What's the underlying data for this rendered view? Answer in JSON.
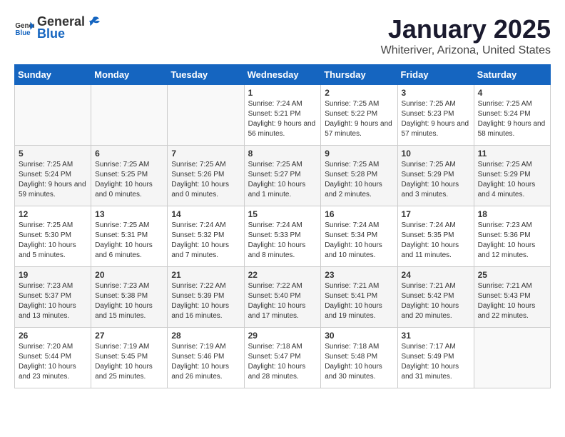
{
  "header": {
    "logo_general": "General",
    "logo_blue": "Blue",
    "title": "January 2025",
    "subtitle": "Whiteriver, Arizona, United States"
  },
  "days_of_week": [
    "Sunday",
    "Monday",
    "Tuesday",
    "Wednesday",
    "Thursday",
    "Friday",
    "Saturday"
  ],
  "weeks": [
    [
      {
        "day": "",
        "sunrise": "",
        "sunset": "",
        "daylight": ""
      },
      {
        "day": "",
        "sunrise": "",
        "sunset": "",
        "daylight": ""
      },
      {
        "day": "",
        "sunrise": "",
        "sunset": "",
        "daylight": ""
      },
      {
        "day": "1",
        "sunrise": "7:24 AM",
        "sunset": "5:21 PM",
        "daylight": "9 hours and 56 minutes."
      },
      {
        "day": "2",
        "sunrise": "7:25 AM",
        "sunset": "5:22 PM",
        "daylight": "9 hours and 57 minutes."
      },
      {
        "day": "3",
        "sunrise": "7:25 AM",
        "sunset": "5:23 PM",
        "daylight": "9 hours and 57 minutes."
      },
      {
        "day": "4",
        "sunrise": "7:25 AM",
        "sunset": "5:24 PM",
        "daylight": "9 hours and 58 minutes."
      }
    ],
    [
      {
        "day": "5",
        "sunrise": "7:25 AM",
        "sunset": "5:24 PM",
        "daylight": "9 hours and 59 minutes."
      },
      {
        "day": "6",
        "sunrise": "7:25 AM",
        "sunset": "5:25 PM",
        "daylight": "10 hours and 0 minutes."
      },
      {
        "day": "7",
        "sunrise": "7:25 AM",
        "sunset": "5:26 PM",
        "daylight": "10 hours and 0 minutes."
      },
      {
        "day": "8",
        "sunrise": "7:25 AM",
        "sunset": "5:27 PM",
        "daylight": "10 hours and 1 minute."
      },
      {
        "day": "9",
        "sunrise": "7:25 AM",
        "sunset": "5:28 PM",
        "daylight": "10 hours and 2 minutes."
      },
      {
        "day": "10",
        "sunrise": "7:25 AM",
        "sunset": "5:29 PM",
        "daylight": "10 hours and 3 minutes."
      },
      {
        "day": "11",
        "sunrise": "7:25 AM",
        "sunset": "5:29 PM",
        "daylight": "10 hours and 4 minutes."
      }
    ],
    [
      {
        "day": "12",
        "sunrise": "7:25 AM",
        "sunset": "5:30 PM",
        "daylight": "10 hours and 5 minutes."
      },
      {
        "day": "13",
        "sunrise": "7:25 AM",
        "sunset": "5:31 PM",
        "daylight": "10 hours and 6 minutes."
      },
      {
        "day": "14",
        "sunrise": "7:24 AM",
        "sunset": "5:32 PM",
        "daylight": "10 hours and 7 minutes."
      },
      {
        "day": "15",
        "sunrise": "7:24 AM",
        "sunset": "5:33 PM",
        "daylight": "10 hours and 8 minutes."
      },
      {
        "day": "16",
        "sunrise": "7:24 AM",
        "sunset": "5:34 PM",
        "daylight": "10 hours and 10 minutes."
      },
      {
        "day": "17",
        "sunrise": "7:24 AM",
        "sunset": "5:35 PM",
        "daylight": "10 hours and 11 minutes."
      },
      {
        "day": "18",
        "sunrise": "7:23 AM",
        "sunset": "5:36 PM",
        "daylight": "10 hours and 12 minutes."
      }
    ],
    [
      {
        "day": "19",
        "sunrise": "7:23 AM",
        "sunset": "5:37 PM",
        "daylight": "10 hours and 13 minutes."
      },
      {
        "day": "20",
        "sunrise": "7:23 AM",
        "sunset": "5:38 PM",
        "daylight": "10 hours and 15 minutes."
      },
      {
        "day": "21",
        "sunrise": "7:22 AM",
        "sunset": "5:39 PM",
        "daylight": "10 hours and 16 minutes."
      },
      {
        "day": "22",
        "sunrise": "7:22 AM",
        "sunset": "5:40 PM",
        "daylight": "10 hours and 17 minutes."
      },
      {
        "day": "23",
        "sunrise": "7:21 AM",
        "sunset": "5:41 PM",
        "daylight": "10 hours and 19 minutes."
      },
      {
        "day": "24",
        "sunrise": "7:21 AM",
        "sunset": "5:42 PM",
        "daylight": "10 hours and 20 minutes."
      },
      {
        "day": "25",
        "sunrise": "7:21 AM",
        "sunset": "5:43 PM",
        "daylight": "10 hours and 22 minutes."
      }
    ],
    [
      {
        "day": "26",
        "sunrise": "7:20 AM",
        "sunset": "5:44 PM",
        "daylight": "10 hours and 23 minutes."
      },
      {
        "day": "27",
        "sunrise": "7:19 AM",
        "sunset": "5:45 PM",
        "daylight": "10 hours and 25 minutes."
      },
      {
        "day": "28",
        "sunrise": "7:19 AM",
        "sunset": "5:46 PM",
        "daylight": "10 hours and 26 minutes."
      },
      {
        "day": "29",
        "sunrise": "7:18 AM",
        "sunset": "5:47 PM",
        "daylight": "10 hours and 28 minutes."
      },
      {
        "day": "30",
        "sunrise": "7:18 AM",
        "sunset": "5:48 PM",
        "daylight": "10 hours and 30 minutes."
      },
      {
        "day": "31",
        "sunrise": "7:17 AM",
        "sunset": "5:49 PM",
        "daylight": "10 hours and 31 minutes."
      },
      {
        "day": "",
        "sunrise": "",
        "sunset": "",
        "daylight": ""
      }
    ]
  ],
  "labels": {
    "sunrise": "Sunrise:",
    "sunset": "Sunset:",
    "daylight": "Daylight:"
  }
}
